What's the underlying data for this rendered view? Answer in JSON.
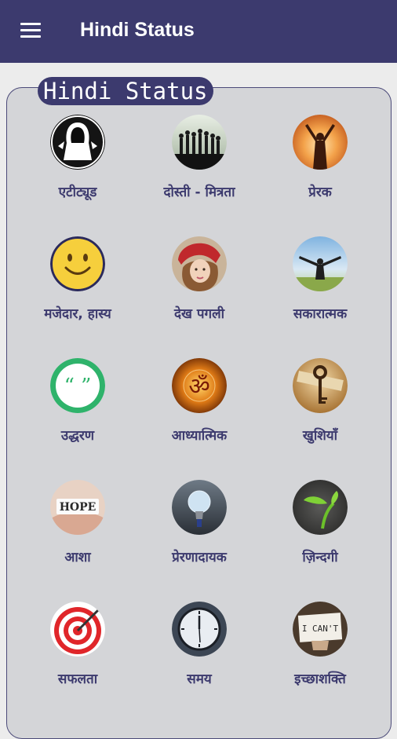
{
  "app_bar": {
    "title": "Hindi Status",
    "menu_icon": "hamburger-menu-icon"
  },
  "card": {
    "badge": "Hindi Status"
  },
  "categories": [
    {
      "label": "एटीट्यूड",
      "icon": "hooded-figure-icon"
    },
    {
      "label": "दोस्ती - मित्रता",
      "icon": "friends-silhouette-icon"
    },
    {
      "label": "प्रेरक",
      "icon": "raised-arms-sunset-icon"
    },
    {
      "label": "मजेदार, हास्य",
      "icon": "smiley-face-icon"
    },
    {
      "label": "देख पगली",
      "icon": "girl-red-hat-icon"
    },
    {
      "label": "सकारात्मक",
      "icon": "open-arms-sky-icon"
    },
    {
      "label": "उद्धरण",
      "icon": "quote-marks-icon"
    },
    {
      "label": "आध्यात्मिक",
      "icon": "om-symbol-icon"
    },
    {
      "label": "खुशियाँ",
      "icon": "happiness-key-icon"
    },
    {
      "label": "आशा",
      "icon": "hope-hands-icon"
    },
    {
      "label": "प्रेरणादायक",
      "icon": "lightbulb-icon"
    },
    {
      "label": "ज़िन्दगी",
      "icon": "sprout-icon"
    },
    {
      "label": "सफलता",
      "icon": "target-arrow-icon"
    },
    {
      "label": "समय",
      "icon": "clock-icon"
    },
    {
      "label": "इच्छाशक्ति",
      "icon": "i-cant-paper-icon"
    }
  ]
}
